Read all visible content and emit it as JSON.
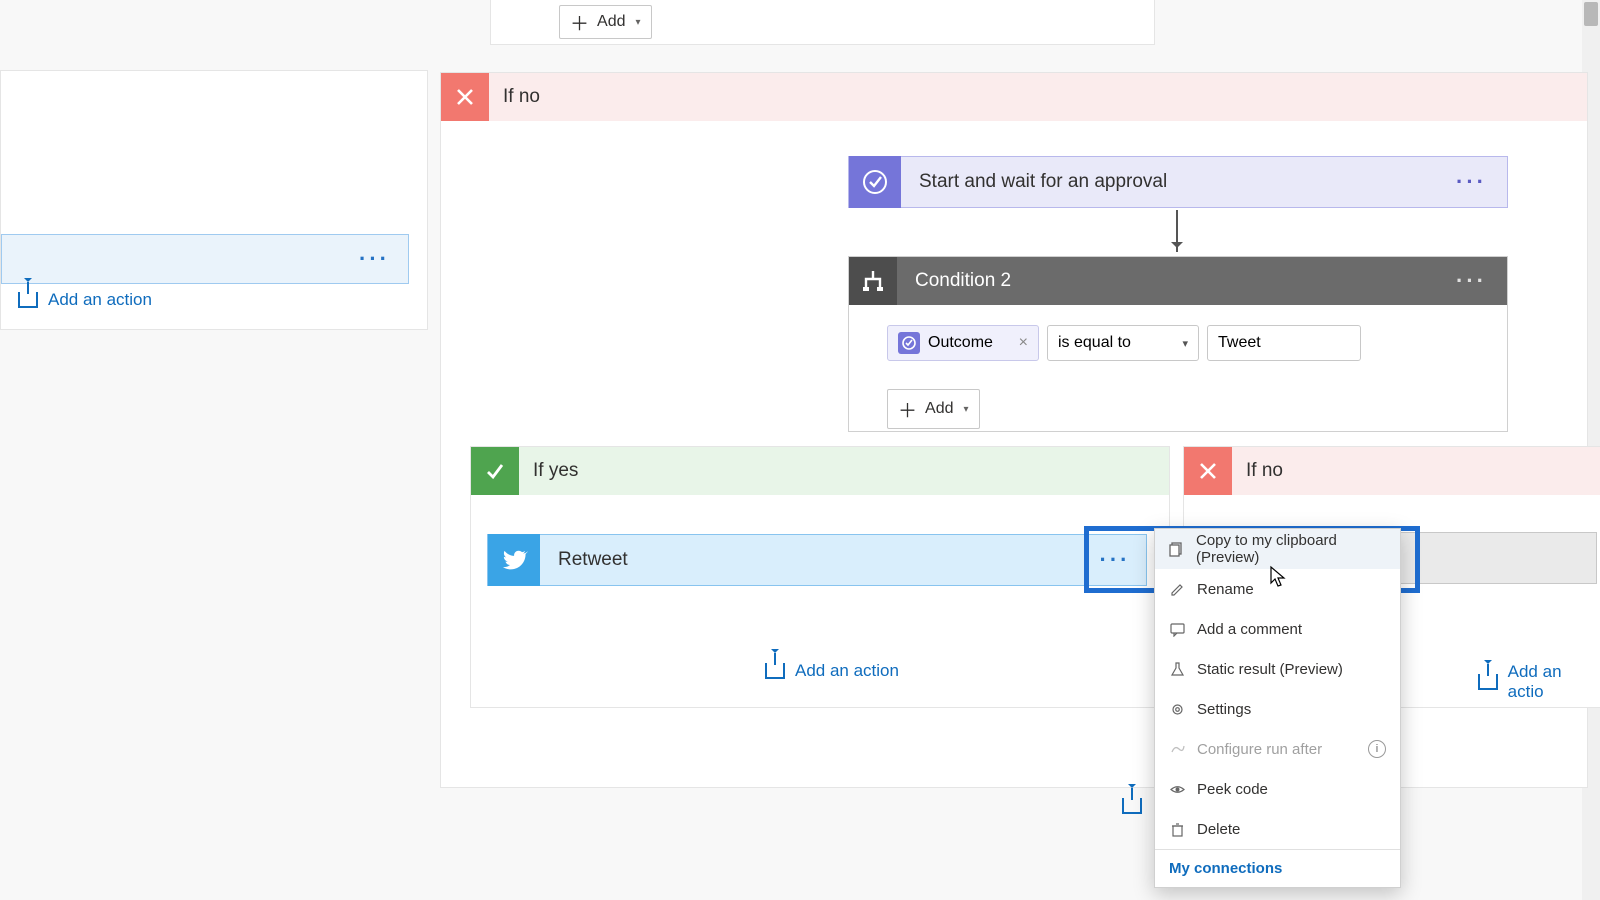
{
  "top": {
    "add_label": "Add"
  },
  "left_card": {
    "more": "···"
  },
  "add_action": "Add an action",
  "branch_no": "If no",
  "branch_yes": "If yes",
  "approval": {
    "title": "Start and wait for an approval"
  },
  "condition": {
    "title": "Condition 2",
    "token": "Outcome",
    "operator": "is equal to",
    "value": "Tweet",
    "add": "Add"
  },
  "retweet": {
    "title": "Retweet"
  },
  "ctx": {
    "copy": "Copy to my clipboard (Preview)",
    "rename": "Rename",
    "comment": "Add a comment",
    "static": "Static result (Preview)",
    "settings": "Settings",
    "runafter": "Configure run after",
    "peek": "Peek code",
    "delete": "Delete",
    "connections": "My connections"
  },
  "add_action_right": "Add an actio"
}
